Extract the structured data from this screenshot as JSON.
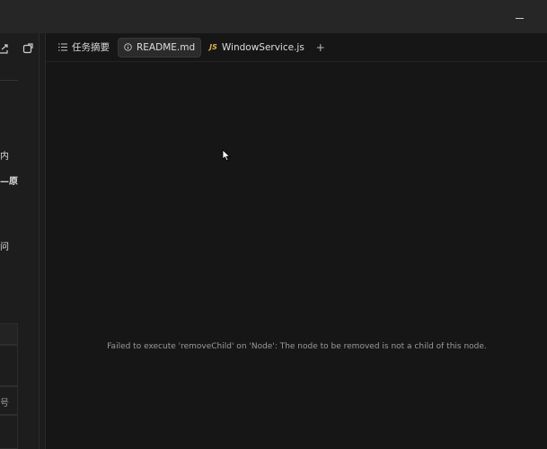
{
  "window": {
    "minimize_icon": "minimize-icon"
  },
  "sidebar": {
    "icons": [
      "share-icon",
      "new-window-icon"
    ],
    "text_fragments": [
      {
        "text": "内",
        "bold": false
      },
      {
        "text": "—原",
        "bold": true
      },
      {
        "text": "问",
        "bold": false
      },
      {
        "text": "号",
        "bold": false
      }
    ]
  },
  "tabs": [
    {
      "icon": "list-icon",
      "label": "任务摘要",
      "active": false
    },
    {
      "icon": "info-icon",
      "label": "README.md",
      "active": true
    },
    {
      "icon": "JS",
      "label": "WindowService.js",
      "active": false
    }
  ],
  "add_tab_label": "+",
  "editor": {
    "error_message": "Failed to execute 'removeChild' on 'Node': The node to be removed is not a child of this node."
  }
}
